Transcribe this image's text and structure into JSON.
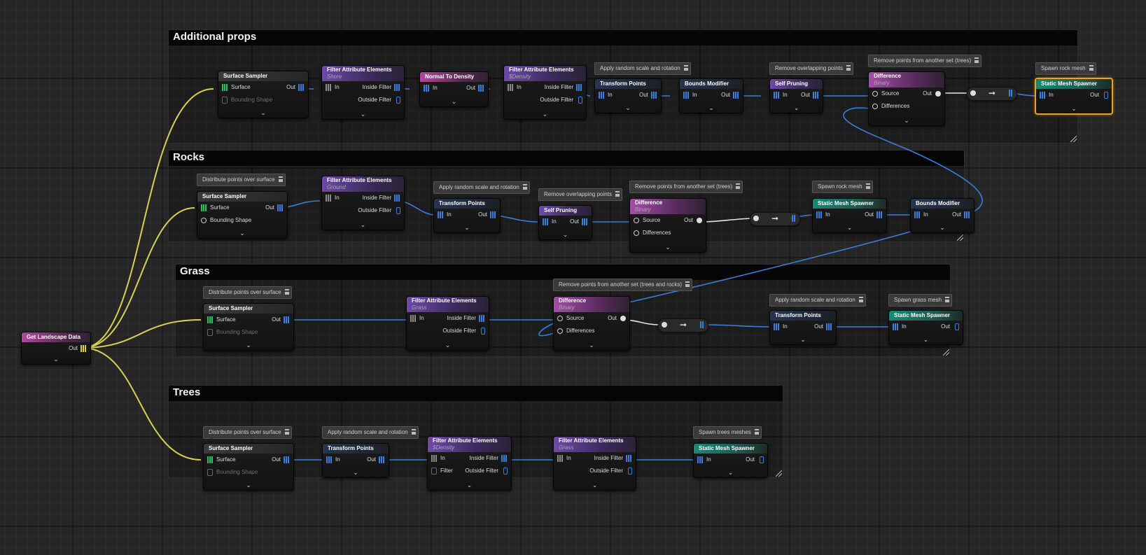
{
  "groups": {
    "additional_props": "Additional props",
    "rocks": "Rocks",
    "grass": "Grass",
    "trees": "Trees"
  },
  "source": {
    "title": "Get Landscape Data",
    "out": "Out"
  },
  "common": {
    "surface": "Surface",
    "out": "Out",
    "in": "In",
    "bounding": "Bounding Shape",
    "inside": "Inside Filter",
    "outside": "Outside Filter",
    "filter": "Filter",
    "source_pin": "Source",
    "differences": "Differences",
    "surface_sampler": "Surface Sampler",
    "filter_attr": "Filter Attribute Elements",
    "transform": "Transform Points",
    "bounds": "Bounds Modifier",
    "self_pruning": "Self Pruning",
    "difference": "Difference",
    "binary": "Binary",
    "normal_density": "Normal To Density",
    "mesh_spawner": "Static Mesh Spawner",
    "arrow": "➞"
  },
  "comments": {
    "props_transform": "Apply random scale and rotation",
    "props_overlap": "Remove overlapping points",
    "props_diff": "Remove points from another set (trees)",
    "props_spawn": "Spawn rock mesh",
    "rocks_distribute": "Distribute points over surface",
    "rocks_transform": "Apply random scale and rotation",
    "rocks_overlap": "Remove overlapping points",
    "rocks_diff": "Remove points from another set (trees)",
    "rocks_spawn": "Spawn rock mesh",
    "grass_distribute": "Distribute points over surface",
    "grass_diff": "Remove points from another set (trees and rocks)",
    "grass_transform": "Apply random scale and rotation",
    "grass_spawn": "Spawn grass mesh",
    "trees_distribute": "Distribute points over surface",
    "trees_transform": "Apply random scale and rotation",
    "trees_spawn": "Spawn trees meshes"
  },
  "filters": {
    "shore": "Shore",
    "density": "$Density",
    "ground": "Ground",
    "grass": "Grass"
  },
  "colors": {
    "spatial_pin": "#3b7de0",
    "landscape_pin": "#e0d040",
    "surface_pin": "#22c55e",
    "wire_blue": "#3b7de0",
    "wire_yellow": "#d8d050",
    "wire_white": "#e6e6e6",
    "selection": "#f0a020"
  }
}
